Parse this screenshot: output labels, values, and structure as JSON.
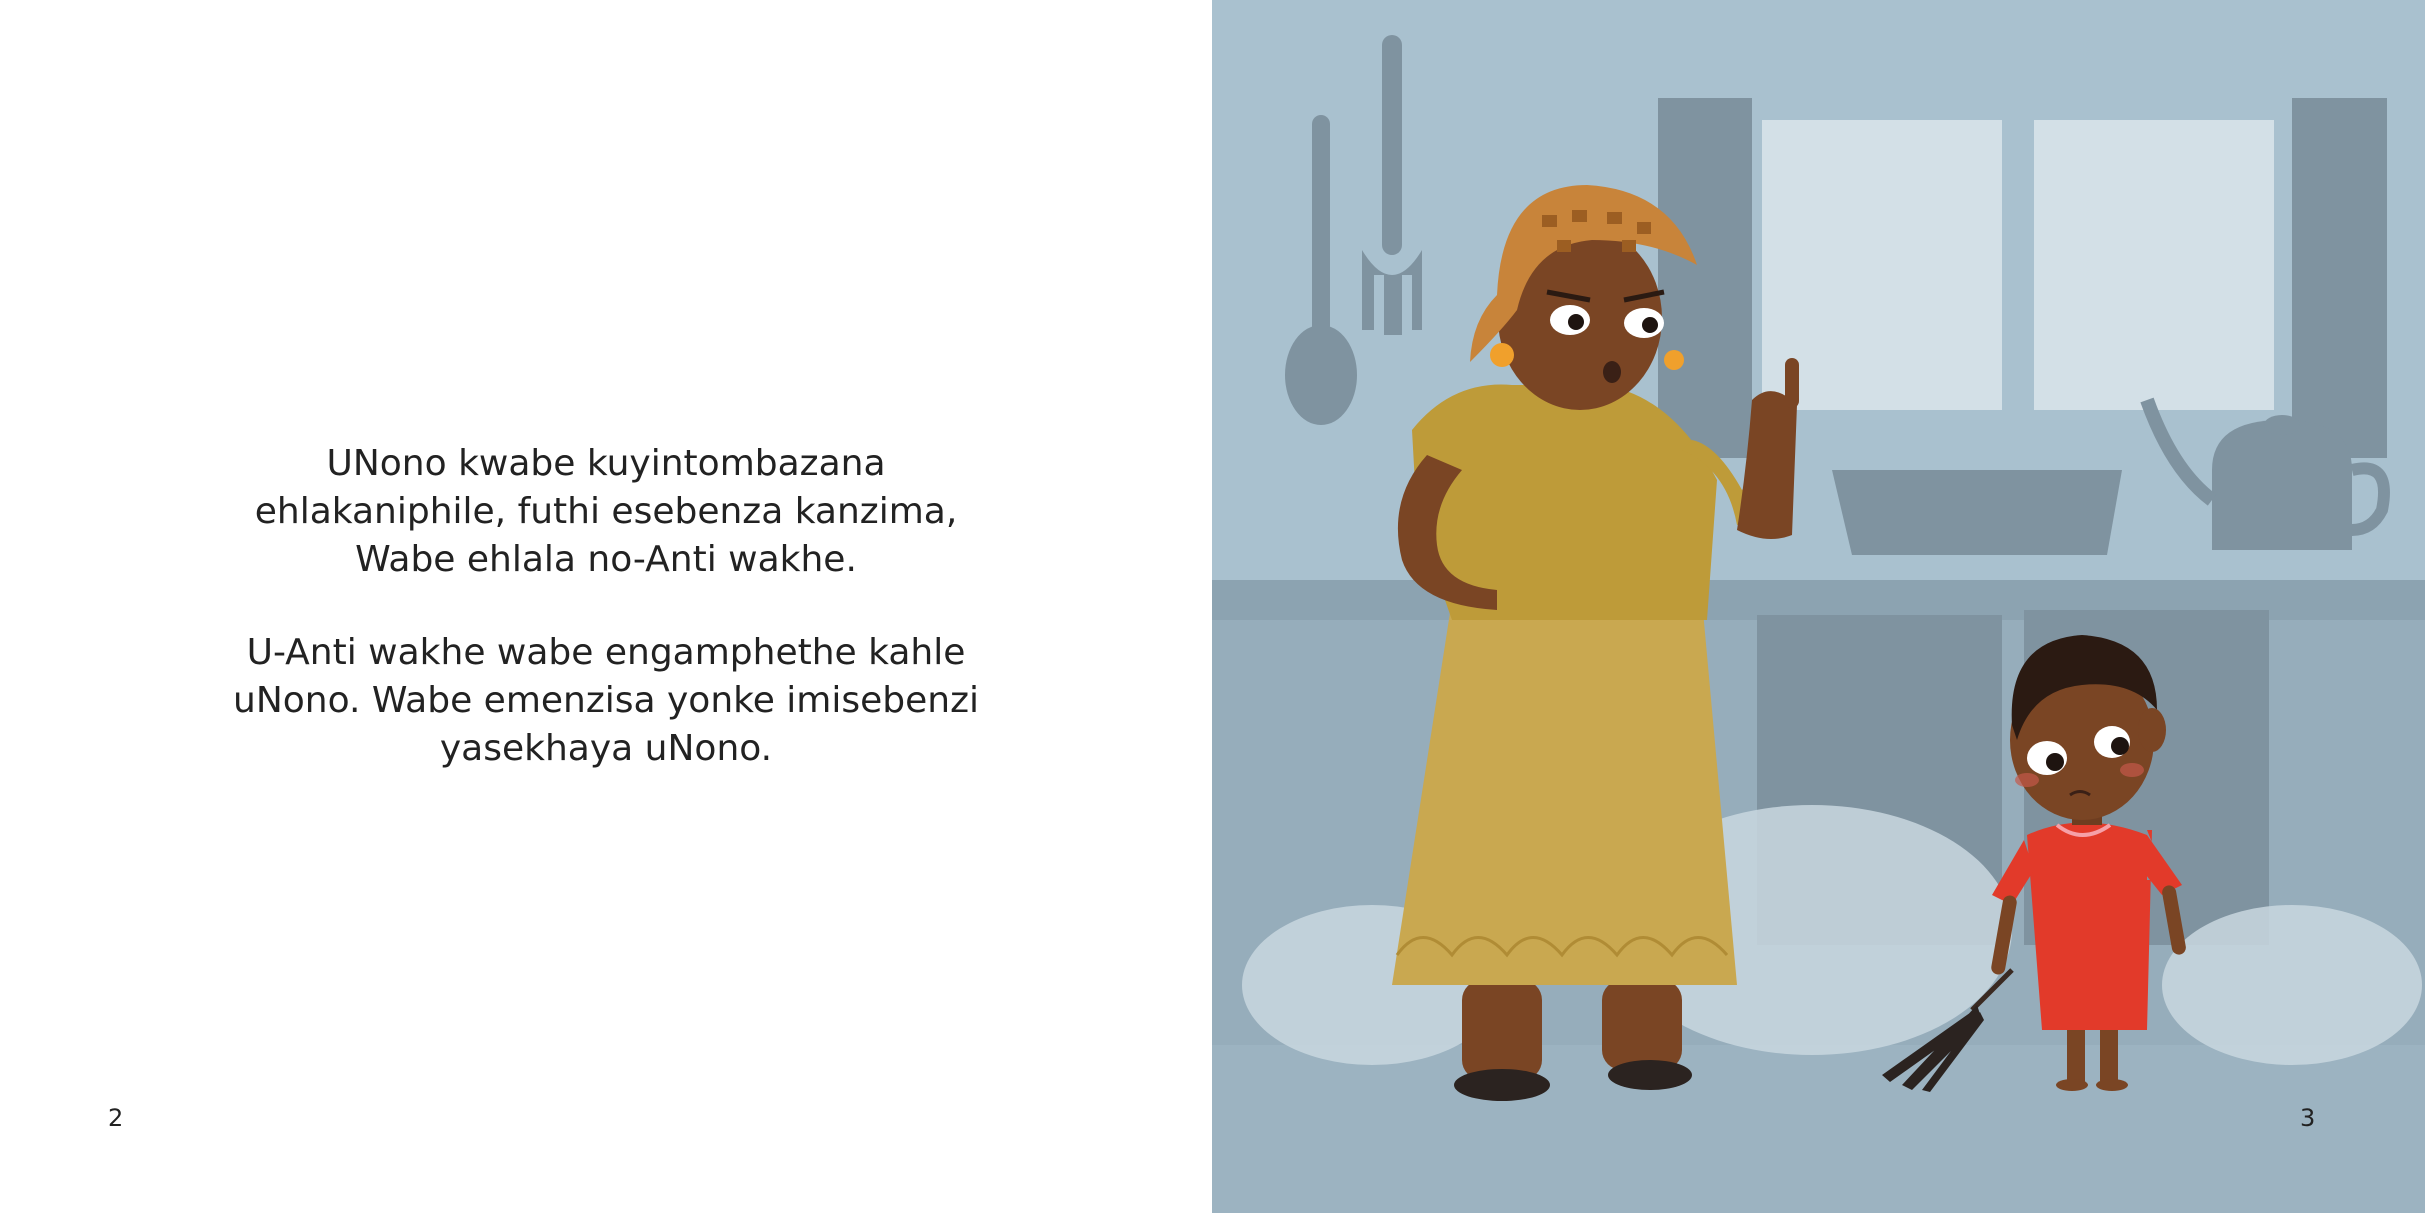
{
  "book": {
    "left_page": {
      "paragraphs": [
        {
          "lines": [
            "UNono kwabe kuyintombazana",
            "ehlakaniphile, futhi esebenza kanzima,",
            "Wabe ehlala no-Anti wakhe."
          ]
        },
        {
          "lines": [
            "U-Anti wakhe wabe engamphethe kahle",
            "uNono. Wabe emenzisa  yonke imisebenzi",
            "yasekhaya uNono."
          ]
        }
      ],
      "page_number": "2"
    },
    "right_page": {
      "page_number": "3",
      "illustration": {
        "scene": "kitchen",
        "characters": [
          "aunt",
          "nono"
        ],
        "colors": {
          "background": "#A9C1CF",
          "counter": "#96ADBB",
          "aunt_dress": "#C7A54B",
          "aunt_headscarf": "#C8843A",
          "nono_dress": "#E23A2A",
          "skin": "#7A4524"
        }
      }
    }
  }
}
